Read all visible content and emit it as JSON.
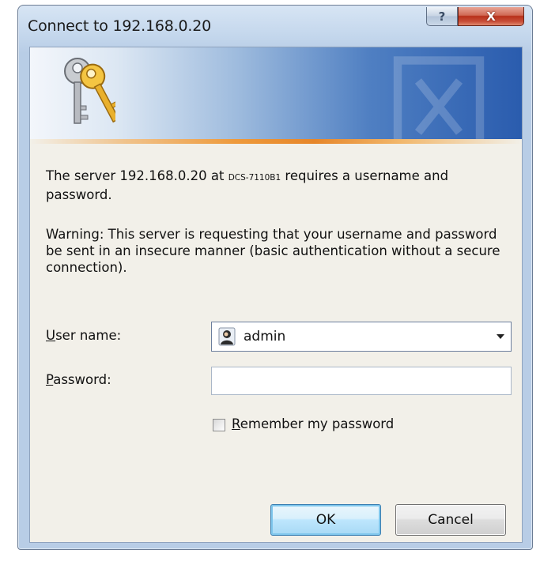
{
  "window": {
    "title": "Connect to 192.168.0.20"
  },
  "titlebar": {
    "help_glyph": "?",
    "close_glyph": "X"
  },
  "message": {
    "prefix": "The server 192.168.0.20 at ",
    "realm": "DCS-7110B1",
    "suffix": " requires a username and password."
  },
  "warning": {
    "text": "Warning: This server is requesting that your username and password be sent in an insecure manner (basic authentication without a secure connection)."
  },
  "form": {
    "username_label_accel": "U",
    "username_label_rest": "ser name:",
    "username_value": "admin",
    "password_label_accel": "P",
    "password_label_rest": "assword:",
    "password_value": "",
    "remember_accel": "R",
    "remember_rest": "emember my password",
    "remember_checked": false
  },
  "buttons": {
    "ok_label": "OK",
    "cancel_label": "Cancel"
  },
  "icons": {
    "banner": "keys-icon",
    "user": "user-icon",
    "dropdown": "chevron-down-icon"
  },
  "colors": {
    "banner_blue": "#2a5cae",
    "accent_orange": "#ee9a3c",
    "close_red": "#b8301a"
  }
}
